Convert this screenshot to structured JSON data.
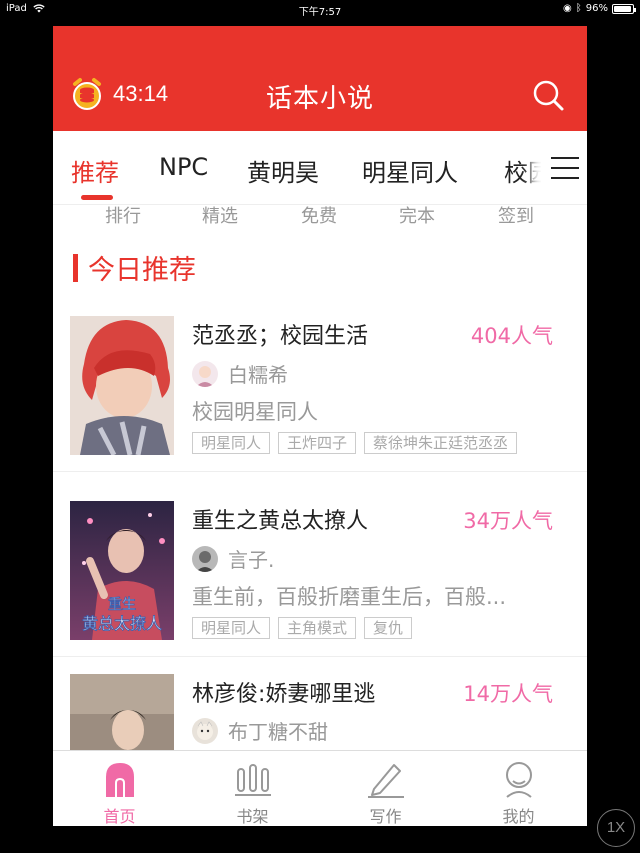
{
  "status_bar": {
    "device": "iPad",
    "time": "下午7:57",
    "battery": "96%",
    "battery_level": 0.96
  },
  "header": {
    "timer": "43:14",
    "title": "话本小说"
  },
  "tabs": [
    {
      "label": "推荐",
      "active": true
    },
    {
      "label": "NPC",
      "active": false
    },
    {
      "label": "黄明昊",
      "active": false
    },
    {
      "label": "明星同人",
      "active": false
    },
    {
      "label": "校园",
      "active": false
    }
  ],
  "subnav": [
    "排行",
    "精选",
    "免费",
    "完本",
    "签到"
  ],
  "section": {
    "title": "今日推荐"
  },
  "books": [
    {
      "title": "范丞丞；校园生活",
      "popularity": "404人气",
      "author": "白糯希",
      "desc": "校园明星同人",
      "tags": [
        "明星同人",
        "王炸四子",
        "蔡徐坤朱正廷范丞丞"
      ],
      "cover_color": "#d9443f"
    },
    {
      "title": "重生之黄总太撩人",
      "popularity": "34万人气",
      "author": "言子.",
      "desc": "重生前，百般折磨重生后，百般...",
      "tags": [
        "明星同人",
        "主角模式",
        "复仇"
      ],
      "cover_text": "重生之黄总太撩人",
      "cover_color": "#4a2a5e"
    },
    {
      "title": "林彦俊:娇妻哪里逃",
      "popularity": "14万人气",
      "author": "布丁糖不甜",
      "desc": "",
      "tags": [],
      "cover_color": "#9c8d80"
    }
  ],
  "bottom_nav": [
    {
      "label": "首页",
      "icon": "home-icon",
      "active": true
    },
    {
      "label": "书架",
      "icon": "bookshelf-icon",
      "active": false
    },
    {
      "label": "写作",
      "icon": "pen-icon",
      "active": false
    },
    {
      "label": "我的",
      "icon": "profile-icon",
      "active": false
    }
  ],
  "zoom": "1X",
  "colors": {
    "brand_red": "#e8342c",
    "pink": "#f06aa6",
    "gray_text": "#999999"
  }
}
